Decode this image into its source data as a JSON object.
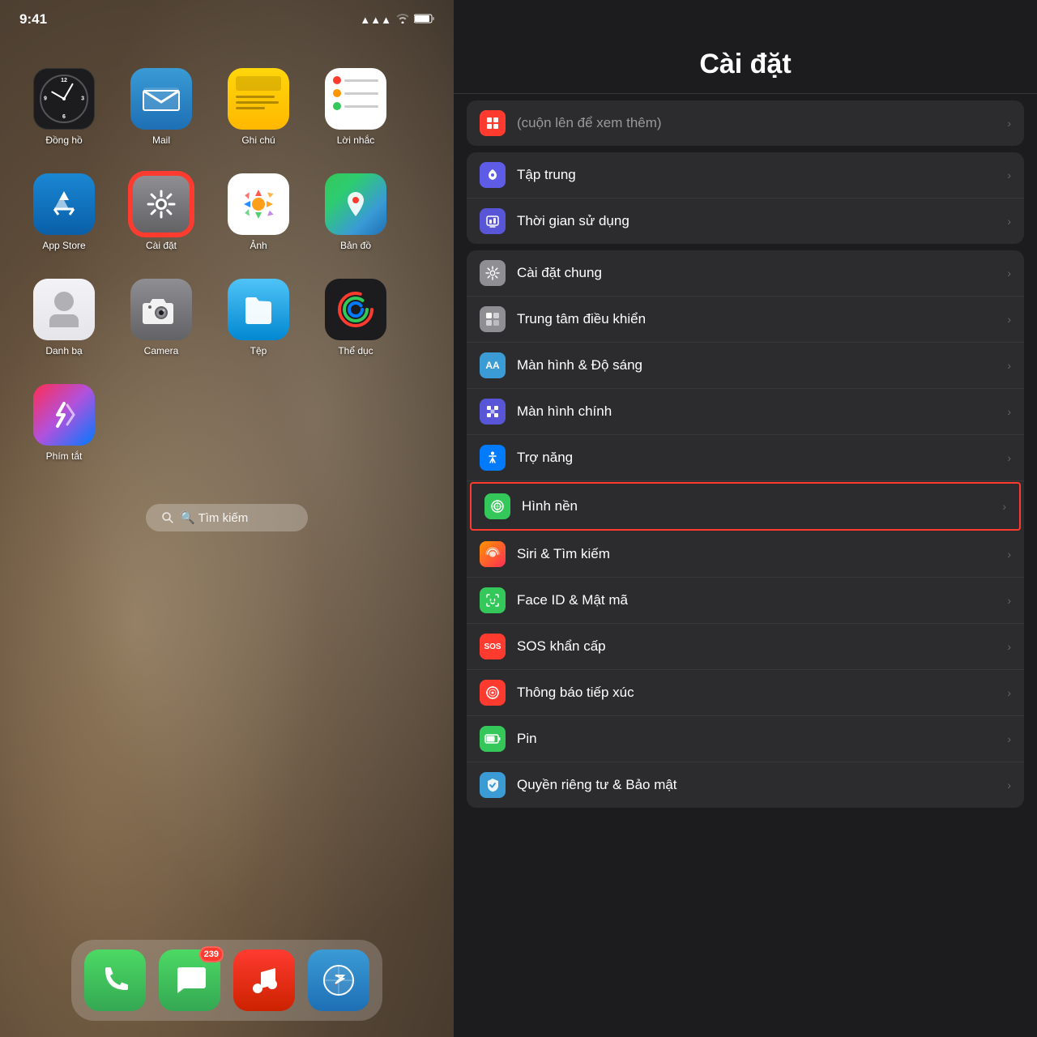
{
  "left": {
    "status": {
      "time": "9:41",
      "icons": "▲ WiFi 🔋"
    },
    "apps": [
      {
        "id": "clock",
        "label": "Đồng hồ",
        "icon_type": "clock",
        "highlighted": false
      },
      {
        "id": "mail",
        "label": "Mail",
        "icon_type": "mail",
        "highlighted": false
      },
      {
        "id": "notes",
        "label": "Ghi chú",
        "icon_type": "notes",
        "highlighted": false
      },
      {
        "id": "reminders",
        "label": "Lời nhắc",
        "icon_type": "reminders",
        "highlighted": false
      },
      {
        "id": "appstore",
        "label": "App Store",
        "icon_type": "appstore",
        "highlighted": false
      },
      {
        "id": "settings",
        "label": "Cài đặt",
        "icon_type": "settings",
        "highlighted": true
      },
      {
        "id": "photos",
        "label": "Ảnh",
        "icon_type": "photos",
        "highlighted": false
      },
      {
        "id": "maps",
        "label": "Bản đồ",
        "icon_type": "maps",
        "highlighted": false
      },
      {
        "id": "contacts",
        "label": "Danh bạ",
        "icon_type": "contacts",
        "highlighted": false
      },
      {
        "id": "camera",
        "label": "Camera",
        "icon_type": "camera",
        "highlighted": false
      },
      {
        "id": "files",
        "label": "Tệp",
        "icon_type": "files",
        "highlighted": false
      },
      {
        "id": "fitness",
        "label": "Thể dục",
        "icon_type": "fitness",
        "highlighted": false
      },
      {
        "id": "shortcuts",
        "label": "Phím tắt",
        "icon_type": "shortcuts",
        "highlighted": false
      }
    ],
    "search": {
      "placeholder": "🔍 Tìm kiếm"
    },
    "dock": [
      {
        "id": "phone",
        "label": "Phone",
        "icon_type": "phone"
      },
      {
        "id": "messages",
        "label": "Messages",
        "icon_type": "messages",
        "badge": "239"
      },
      {
        "id": "music",
        "label": "Music",
        "icon_type": "music"
      },
      {
        "id": "safari",
        "label": "Safari",
        "icon_type": "safari"
      }
    ]
  },
  "right": {
    "title": "Cài đặt",
    "top_partial_icon": "🔴",
    "sections": [
      {
        "id": "section1",
        "rows": [
          {
            "id": "focus",
            "icon_type": "focus",
            "icon_color": "ic-focus",
            "label": "Tập trung",
            "icon_char": "🌙"
          },
          {
            "id": "screen_time",
            "icon_type": "screen_time",
            "icon_color": "ic-screen-time",
            "label": "Thời gian sử dụng",
            "icon_char": "⏳"
          }
        ]
      },
      {
        "id": "section2",
        "rows": [
          {
            "id": "general",
            "icon_type": "general",
            "icon_color": "ic-general",
            "label": "Cài đặt chung",
            "icon_char": "⚙️"
          },
          {
            "id": "control",
            "icon_type": "control",
            "icon_color": "ic-control",
            "label": "Trung tâm điều khiển",
            "icon_char": "🎛"
          },
          {
            "id": "display",
            "icon_type": "display",
            "icon_color": "ic-display",
            "label": "Màn hình & Độ sáng",
            "icon_char": "AA"
          },
          {
            "id": "home_screen",
            "icon_type": "home_screen",
            "icon_color": "ic-home-screen",
            "label": "Màn hình chính",
            "icon_char": "▦"
          },
          {
            "id": "accessibility",
            "icon_type": "accessibility",
            "icon_color": "ic-accessibility",
            "label": "Trợ năng",
            "icon_char": "♿"
          },
          {
            "id": "wallpaper",
            "icon_type": "wallpaper",
            "icon_color": "ic-wallpaper",
            "label": "Hình nền",
            "icon_char": "✿",
            "highlighted": true
          },
          {
            "id": "siri",
            "icon_type": "siri",
            "icon_color": "ic-siri",
            "label": "Siri & Tìm kiếm",
            "icon_char": "🎙"
          },
          {
            "id": "faceid",
            "icon_type": "faceid",
            "icon_color": "ic-faceid",
            "label": "Face ID & Mật mã",
            "icon_char": "😊"
          },
          {
            "id": "sos",
            "icon_type": "sos",
            "icon_color": "ic-sos",
            "label": "SOS khẩn cấp",
            "icon_char": "SOS"
          },
          {
            "id": "exposure",
            "icon_type": "exposure",
            "icon_color": "ic-exposure",
            "label": "Thông báo tiếp xúc",
            "icon_char": "◎"
          },
          {
            "id": "battery",
            "icon_type": "battery",
            "icon_color": "ic-battery",
            "label": "Pin",
            "icon_char": "🔋"
          },
          {
            "id": "privacy",
            "icon_type": "privacy",
            "icon_color": "ic-privacy",
            "label": "Quyền riêng tư & Bảo mật",
            "icon_char": "✋"
          }
        ]
      }
    ]
  }
}
